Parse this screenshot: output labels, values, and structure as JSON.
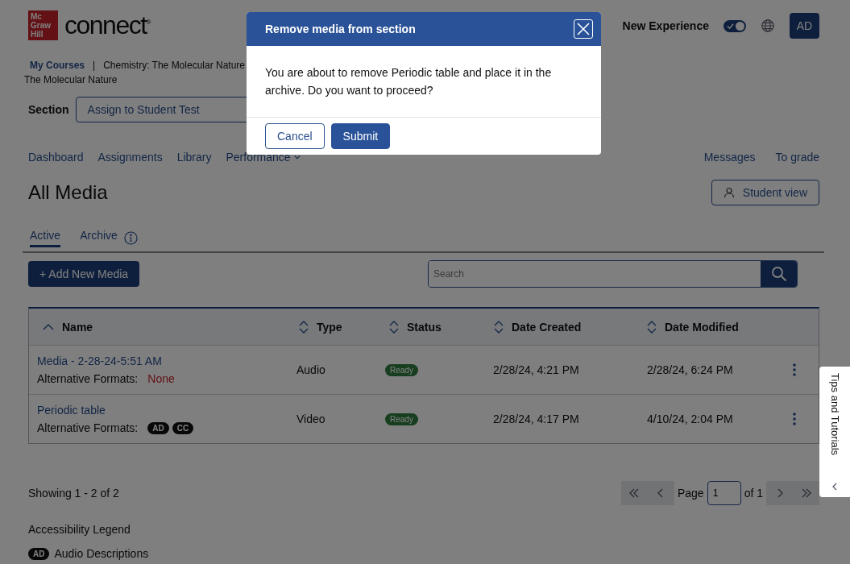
{
  "header": {
    "logo_box": [
      "Mc",
      "Graw",
      "Hill"
    ],
    "logo_word": "connect$^{®}$",
    "new_experience": {
      "label": "New Experience",
      "on": true
    },
    "avatar": "AD"
  },
  "breadcrumb": {
    "link": "My Courses",
    "separator": "|",
    "course_line_1": "Chemistry: The Molecular Nature",
    "course_line_2": "The Molecular Nature"
  },
  "section": {
    "label": "Section",
    "value": "Assign to Student Test"
  },
  "nav": {
    "left": [
      {
        "label": "Dashboard",
        "dropdown": false
      },
      {
        "label": "Assignments",
        "dropdown": false
      },
      {
        "label": "Library",
        "dropdown": false
      },
      {
        "label": "Performance",
        "dropdown": true
      }
    ],
    "right": [
      "Messages",
      "To grade"
    ]
  },
  "page_title": "All Media",
  "student_view": "Student view",
  "tabs": [
    {
      "label": "Active",
      "selected": true,
      "info": false
    },
    {
      "label": "Archive",
      "selected": false,
      "info": true
    }
  ],
  "add_button": "+ Add New Media",
  "search": {
    "placeholder": "Search"
  },
  "table": {
    "columns": [
      {
        "label": "Name",
        "sorted": true
      },
      {
        "label": "Type",
        "sorted": false
      },
      {
        "label": "Status",
        "sorted": false
      },
      {
        "label": "Date Created",
        "sorted": false
      },
      {
        "label": "Date Modified",
        "sorted": false
      }
    ],
    "rows": [
      {
        "name": "Media - 2-28-24-5:51 AM",
        "formats_label": "Alternative Formats:",
        "formats": {
          "kind": "none",
          "text": "None"
        },
        "type": "Audio",
        "status": "Ready",
        "created": "2/28/24, 4:21 PM",
        "modified": "2/28/24, 6:24 PM"
      },
      {
        "name": "Periodic table",
        "formats_label": "Alternative Formats:",
        "formats": {
          "kind": "badges",
          "badges": [
            "AD",
            "CC"
          ]
        },
        "type": "Video",
        "status": "Ready",
        "created": "2/28/24, 4:17 PM",
        "modified": "4/10/24, 2:04 PM"
      }
    ]
  },
  "showing": "Showing 1 - 2 of 2",
  "pagination": {
    "page_label": "Page",
    "page_value": "1",
    "of": "of 1"
  },
  "legend": {
    "title": "Accessibility Legend",
    "items": [
      {
        "badge": "AD",
        "label": "Audio Descriptions"
      }
    ]
  },
  "tips_tab": "Tips and Tutorials",
  "dialog": {
    "title": "Remove media from section",
    "message": "You are about to remove Periodic table and place it in the archive. Do you want to proceed?",
    "buttons": [
      {
        "label": "Cancel",
        "kind": "secondary"
      },
      {
        "label": "Submit",
        "kind": "primary"
      }
    ]
  }
}
